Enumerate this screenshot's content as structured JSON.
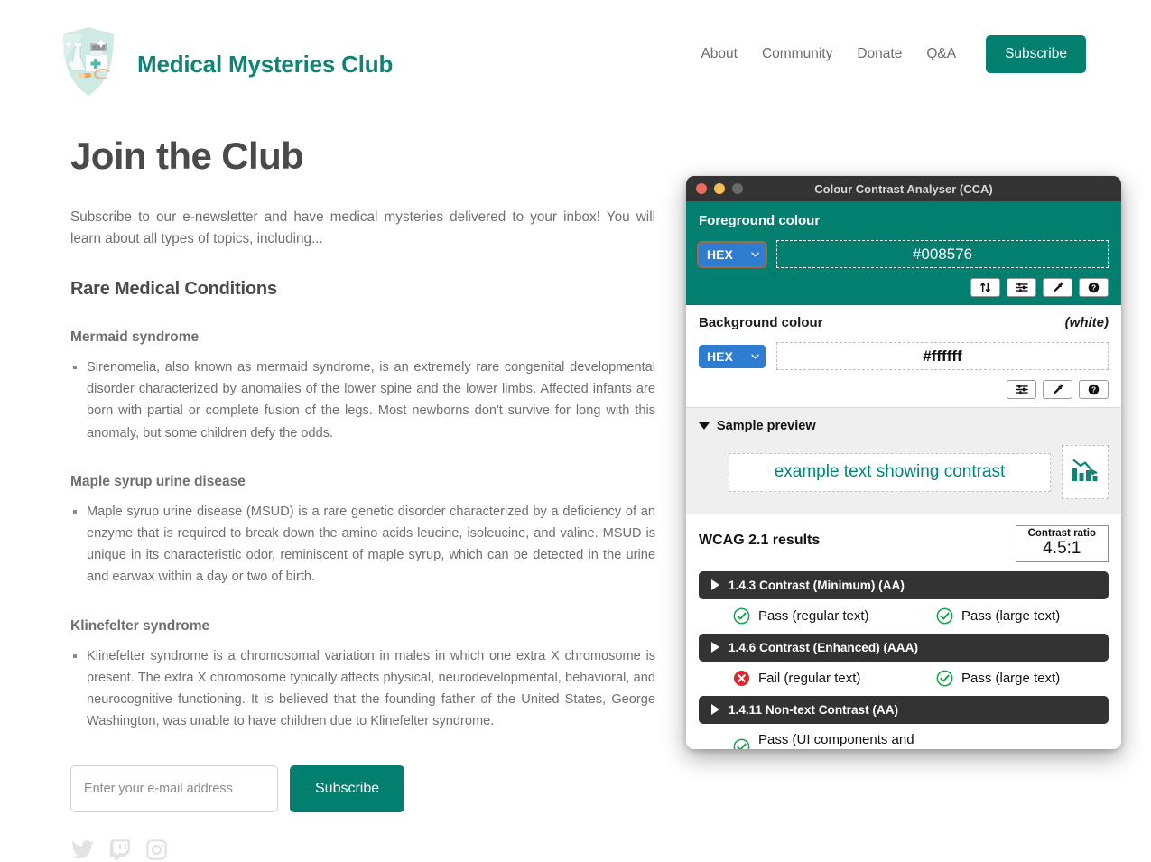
{
  "site": {
    "brand": {
      "title": "Medical Mysteries Club",
      "logo_icon": "shield-lab-badge-icon"
    },
    "nav": {
      "links": [
        {
          "label": "About",
          "name": "about"
        },
        {
          "label": "Community",
          "name": "community"
        },
        {
          "label": "Donate",
          "name": "donate"
        },
        {
          "label": "Q&A",
          "name": "qa"
        }
      ],
      "subscribe_label": "Subscribe",
      "accent_color": "#027f6f"
    }
  },
  "main": {
    "page_title": "Join the Club",
    "lede": "Subscribe to our e-newsletter and have medical mysteries delivered to your inbox! You will learn about all types of topics, including...",
    "section_title": "Rare Medical Conditions",
    "conditions": [
      {
        "title": "Mermaid syndrome",
        "body": "Sirenomelia, also known as mermaid syndrome, is an extremely rare congenital developmental disorder characterized by anomalies of the lower spine and the lower limbs. Affected infants are born with partial or complete fusion of the legs. Most newborns don't survive for long with this anomaly, but some children defy the odds."
      },
      {
        "title": "Maple syrup urine disease",
        "body": "Maple syrup urine disease (MSUD) is a rare genetic disorder characterized by a deficiency of an enzyme that is required to break down the amino acids leucine, isoleucine, and valine. MSUD is unique in its characteristic odor, reminiscent of maple syrup, which can be detected in the urine and earwax within a day or two of birth."
      },
      {
        "title": "Klinefelter syndrome",
        "body": "Klinefelter syndrome is a chromosomal variation in males in which one extra X chromosome is present. The extra X chromosome typically affects physical, neurodevelopmental, behavioral, and neurocognitive functioning. It is believed that the founding father of the United States, George Washington, was unable to have children due to Klinefelter syndrome."
      }
    ],
    "signup": {
      "email_placeholder": "Enter your e-mail address",
      "email_value": "",
      "subscribe_label": "Subscribe"
    },
    "socials": [
      {
        "name": "twitter-icon",
        "label": "Twitter"
      },
      {
        "name": "twitch-icon",
        "label": "Twitch"
      },
      {
        "name": "instagram-icon",
        "label": "Instagram"
      }
    ]
  },
  "cca": {
    "window_title": "Colour Contrast Analyser (CCA)",
    "traffic_lights": [
      {
        "name": "close",
        "color": "#ed6a5e"
      },
      {
        "name": "minimize",
        "color": "#f4bd4f"
      },
      {
        "name": "zoom",
        "color": "#6a6a6a"
      }
    ],
    "foreground": {
      "label": "Foreground colour",
      "format": "HEX",
      "value": "#008576",
      "panel_color": "#027f6f",
      "tools": [
        {
          "name": "swap-colours-icon",
          "glyph": "swap"
        },
        {
          "name": "sliders-icon",
          "glyph": "sliders"
        },
        {
          "name": "eyedropper-icon",
          "glyph": "eyedropper"
        },
        {
          "name": "help-icon",
          "glyph": "help"
        }
      ]
    },
    "background": {
      "label": "Background colour",
      "note": "(white)",
      "format": "HEX",
      "value": "#ffffff",
      "tools": [
        {
          "name": "sliders-icon",
          "glyph": "sliders"
        },
        {
          "name": "eyedropper-icon",
          "glyph": "eyedropper"
        },
        {
          "name": "help-icon",
          "glyph": "help"
        }
      ]
    },
    "preview": {
      "label": "Sample preview",
      "sample_text": "example text showing contrast",
      "graphic_icon": "bar-chart-down-arrow-icon"
    },
    "results": {
      "title": "WCAG 2.1 results",
      "ratio_label": "Contrast ratio",
      "ratio_value": "4.5:1",
      "criteria": [
        {
          "label": "1.4.3 Contrast (Minimum) (AA)",
          "verdicts": [
            {
              "status": "pass",
              "label": "Pass (regular text)"
            },
            {
              "status": "pass",
              "label": "Pass (large text)"
            }
          ]
        },
        {
          "label": "1.4.6 Contrast (Enhanced) (AAA)",
          "verdicts": [
            {
              "status": "fail",
              "label": "Fail (regular text)"
            },
            {
              "status": "pass",
              "label": "Pass (large text)"
            }
          ]
        },
        {
          "label": "1.4.11 Non-text Contrast (AA)",
          "verdicts": [
            {
              "status": "pass",
              "label": "Pass (UI components and graphical objects)"
            }
          ]
        }
      ],
      "pass_color": "#14a34a",
      "fail_color": "#d92b2b"
    }
  }
}
